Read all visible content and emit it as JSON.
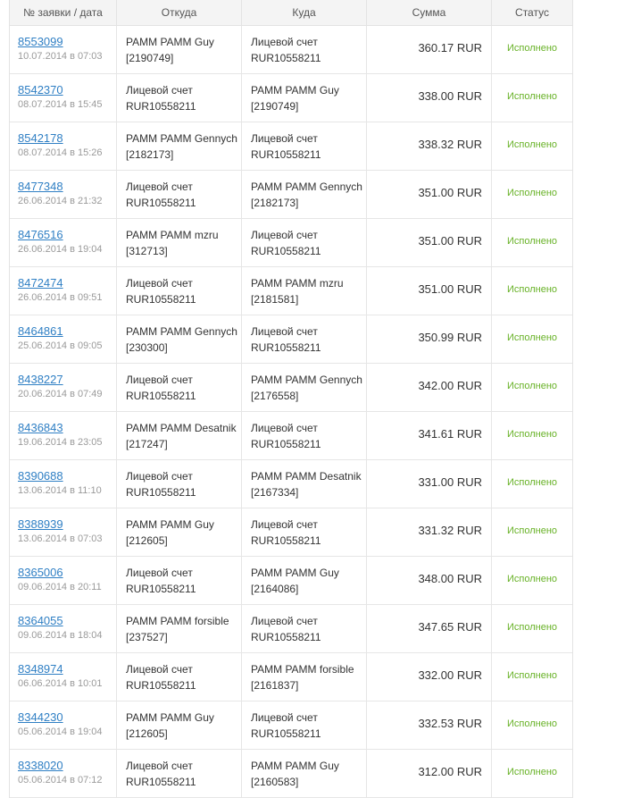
{
  "headers": {
    "id_date": "№ заявки / дата",
    "from": "Откуда",
    "to": "Куда",
    "amount": "Сумма",
    "status": "Статус"
  },
  "rows": [
    {
      "id": "8553099",
      "date": "10.07.2014 в 07:03",
      "from1": "PAMM PAMM Guy",
      "from2": "[2190749]",
      "to1": "Лицевой счет",
      "to2": "RUR10558211",
      "amount": "360.17 RUR",
      "status": "Исполнено"
    },
    {
      "id": "8542370",
      "date": "08.07.2014 в 15:45",
      "from1": "Лицевой счет",
      "from2": "RUR10558211",
      "to1": "PAMM PAMM Guy",
      "to2": "[2190749]",
      "amount": "338.00 RUR",
      "status": "Исполнено"
    },
    {
      "id": "8542178",
      "date": "08.07.2014 в 15:26",
      "from1": "PAMM PAMM Gennych",
      "from2": "[2182173]",
      "to1": "Лицевой счет",
      "to2": "RUR10558211",
      "amount": "338.32 RUR",
      "status": "Исполнено"
    },
    {
      "id": "8477348",
      "date": "26.06.2014 в 21:32",
      "from1": "Лицевой счет",
      "from2": "RUR10558211",
      "to1": "PAMM PAMM Gennych",
      "to2": "[2182173]",
      "amount": "351.00 RUR",
      "status": "Исполнено"
    },
    {
      "id": "8476516",
      "date": "26.06.2014 в 19:04",
      "from1": "PAMM PAMM mzru",
      "from2": "[312713]",
      "to1": "Лицевой счет",
      "to2": "RUR10558211",
      "amount": "351.00 RUR",
      "status": "Исполнено"
    },
    {
      "id": "8472474",
      "date": "26.06.2014 в 09:51",
      "from1": "Лицевой счет",
      "from2": "RUR10558211",
      "to1": "PAMM PAMM mzru",
      "to2": "[2181581]",
      "amount": "351.00 RUR",
      "status": "Исполнено"
    },
    {
      "id": "8464861",
      "date": "25.06.2014 в 09:05",
      "from1": "PAMM PAMM Gennych",
      "from2": "[230300]",
      "to1": "Лицевой счет",
      "to2": "RUR10558211",
      "amount": "350.99 RUR",
      "status": "Исполнено"
    },
    {
      "id": "8438227",
      "date": "20.06.2014 в 07:49",
      "from1": "Лицевой счет",
      "from2": "RUR10558211",
      "to1": "PAMM PAMM Gennych",
      "to2": "[2176558]",
      "amount": "342.00 RUR",
      "status": "Исполнено"
    },
    {
      "id": "8436843",
      "date": "19.06.2014 в 23:05",
      "from1": "PAMM PAMM Desatnik",
      "from2": "[217247]",
      "to1": "Лицевой счет",
      "to2": "RUR10558211",
      "amount": "341.61 RUR",
      "status": "Исполнено"
    },
    {
      "id": "8390688",
      "date": "13.06.2014 в 11:10",
      "from1": "Лицевой счет",
      "from2": "RUR10558211",
      "to1": "PAMM PAMM Desatnik",
      "to2": "[2167334]",
      "amount": "331.00 RUR",
      "status": "Исполнено"
    },
    {
      "id": "8388939",
      "date": "13.06.2014 в 07:03",
      "from1": "PAMM PAMM Guy",
      "from2": "[212605]",
      "to1": "Лицевой счет",
      "to2": "RUR10558211",
      "amount": "331.32 RUR",
      "status": "Исполнено"
    },
    {
      "id": "8365006",
      "date": "09.06.2014 в 20:11",
      "from1": "Лицевой счет",
      "from2": "RUR10558211",
      "to1": "PAMM PAMM Guy",
      "to2": "[2164086]",
      "amount": "348.00 RUR",
      "status": "Исполнено"
    },
    {
      "id": "8364055",
      "date": "09.06.2014 в 18:04",
      "from1": "PAMM PAMM forsible",
      "from2": "[237527]",
      "to1": "Лицевой счет",
      "to2": "RUR10558211",
      "amount": "347.65 RUR",
      "status": "Исполнено"
    },
    {
      "id": "8348974",
      "date": "06.06.2014 в 10:01",
      "from1": "Лицевой счет",
      "from2": "RUR10558211",
      "to1": "PAMM PAMM forsible",
      "to2": "[2161837]",
      "amount": "332.00 RUR",
      "status": "Исполнено"
    },
    {
      "id": "8344230",
      "date": "05.06.2014 в 19:04",
      "from1": "PAMM PAMM Guy",
      "from2": "[212605]",
      "to1": "Лицевой счет",
      "to2": "RUR10558211",
      "amount": "332.53 RUR",
      "status": "Исполнено"
    },
    {
      "id": "8338020",
      "date": "05.06.2014 в 07:12",
      "from1": "Лицевой счет",
      "from2": "RUR10558211",
      "to1": "PAMM PAMM Guy",
      "to2": "[2160583]",
      "amount": "312.00 RUR",
      "status": "Исполнено"
    }
  ],
  "colors": {
    "link": "#2f7fc4",
    "status_done": "#68b227",
    "date": "#9a9a9a"
  }
}
